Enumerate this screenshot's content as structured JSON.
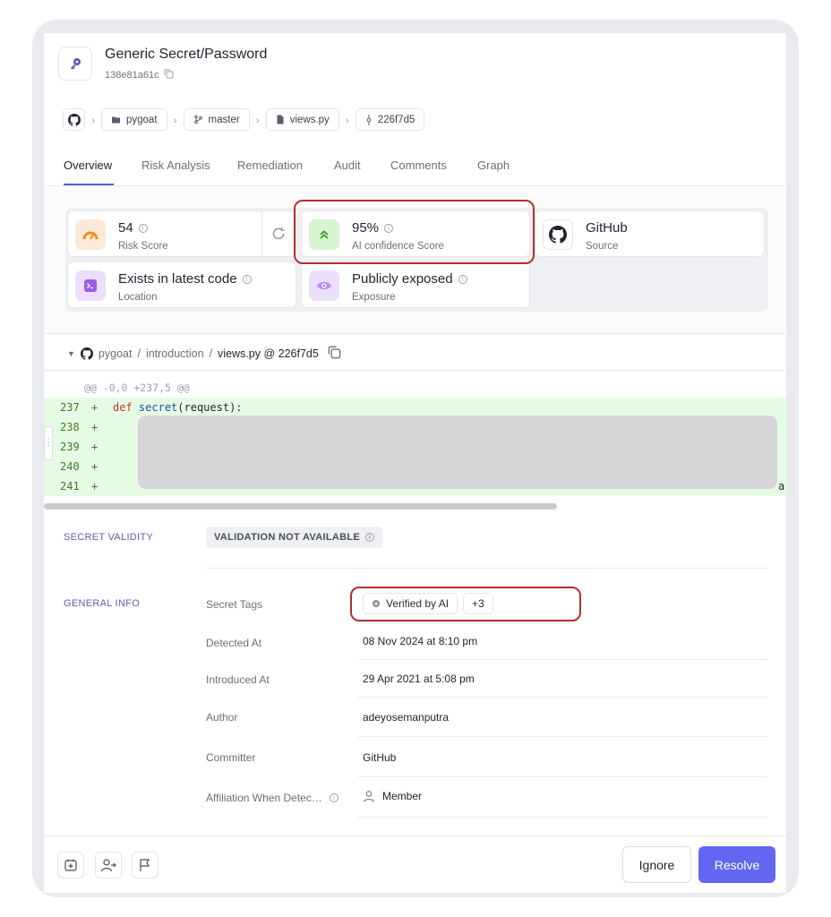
{
  "header": {
    "title": "Generic Secret/Password",
    "secret_id": "138e81a61c"
  },
  "breadcrumb": {
    "repo": "pygoat",
    "branch": "master",
    "file": "views.py",
    "commit": "226f7d5"
  },
  "tabs": [
    "Overview",
    "Risk Analysis",
    "Remediation",
    "Audit",
    "Comments",
    "Graph"
  ],
  "cards": {
    "risk": {
      "value": "54",
      "label": "Risk Score"
    },
    "ai": {
      "value": "95%",
      "label": "AI confidence Score"
    },
    "source": {
      "value": "GitHub",
      "label": "Source"
    },
    "location": {
      "value": "Exists in latest code",
      "label": "Location"
    },
    "exposure": {
      "value": "Publicly exposed",
      "label": "Exposure"
    }
  },
  "file_header": {
    "repo": "pygoat",
    "dir": "introduction",
    "file_ref": "views.py @ 226f7d5"
  },
  "code": {
    "hunk": "@@ -0,0 +237,5 @@",
    "lines": [
      {
        "num": "237",
        "sign": "+",
        "kw": "def",
        "fn": "secret",
        "rest": "(request):"
      },
      {
        "num": "238",
        "sign": "+"
      },
      {
        "num": "239",
        "sign": "+"
      },
      {
        "num": "240",
        "sign": "+"
      },
      {
        "num": "241",
        "sign": "+"
      }
    ],
    "tail_char": "a"
  },
  "validity": {
    "section_label": "SECRET VALIDITY",
    "badge": "VALIDATION NOT AVAILABLE"
  },
  "general_info": {
    "section_label": "GENERAL INFO",
    "secret_tags_label": "Secret Tags",
    "tag": "Verified by AI",
    "more_tags": "+3",
    "detected_label": "Detected At",
    "detected_value": "08 Nov 2024 at 8:10 pm",
    "introduced_label": "Introduced At",
    "introduced_value": "29 Apr 2021 at 5:08 pm",
    "author_label": "Author",
    "author_value": "adeyosemanputra",
    "committer_label": "Committer",
    "committer_value": "GitHub",
    "affiliation_label": "Affiliation When Detec…",
    "affiliation_value": "Member"
  },
  "footer": {
    "ignore": "Ignore",
    "resolve": "Resolve"
  },
  "colors": {
    "accent": "#6366f1",
    "highlight": "#b3302d",
    "added_line_bg": "#e6fbe3"
  }
}
